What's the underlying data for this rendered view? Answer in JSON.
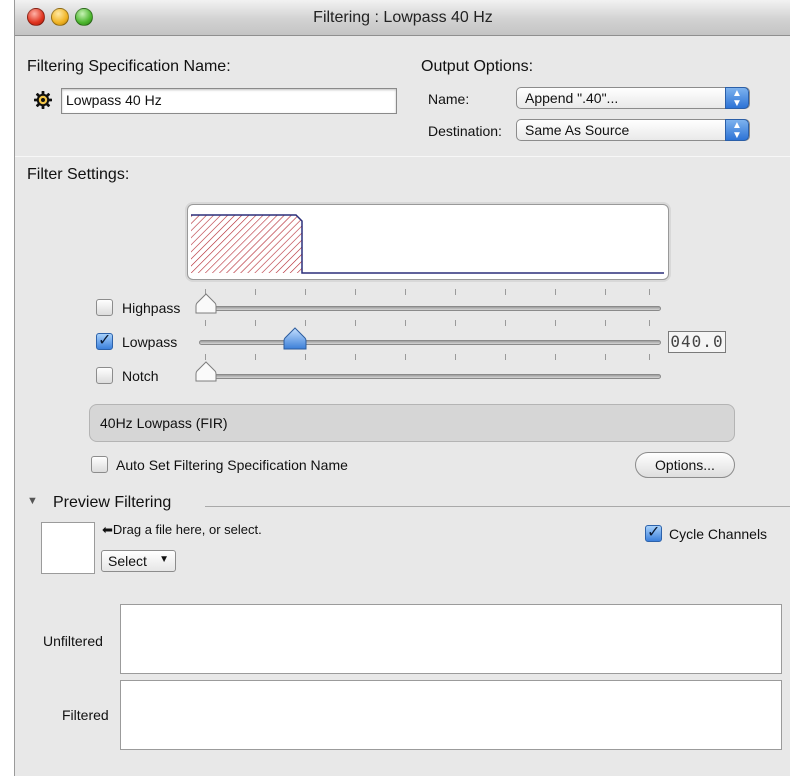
{
  "window": {
    "title": "Filtering : Lowpass 40 Hz"
  },
  "spec": {
    "heading": "Filtering Specification Name:",
    "name_value": "Lowpass 40 Hz",
    "action_icon": "gear-icon"
  },
  "output": {
    "heading": "Output Options:",
    "name_label": "Name:",
    "name_value": "Append \".40\"...",
    "destination_label": "Destination:",
    "destination_value": "Same As Source"
  },
  "filter": {
    "heading": "Filter Settings:",
    "highpass_label": "Highpass",
    "highpass_checked": false,
    "lowpass_label": "Lowpass",
    "lowpass_checked": true,
    "notch_label": "Notch",
    "notch_checked": false,
    "lowpass_readout": "040.0",
    "description": "40Hz Lowpass (FIR)",
    "auto_set_label": "Auto Set Filtering Specification Name",
    "auto_set_checked": false,
    "options_button": "Options..."
  },
  "preview": {
    "heading": "Preview Filtering",
    "drop_hint": "Drag a file here, or select.",
    "select_label": "Select",
    "cycle_label": "Cycle Channels",
    "cycle_checked": true,
    "unfiltered_label": "Unfiltered",
    "filtered_label": "Filtered"
  },
  "colors": {
    "accent": "#3b80dc",
    "hatch": "#b3262f",
    "thumb": "#5f9ee8"
  }
}
